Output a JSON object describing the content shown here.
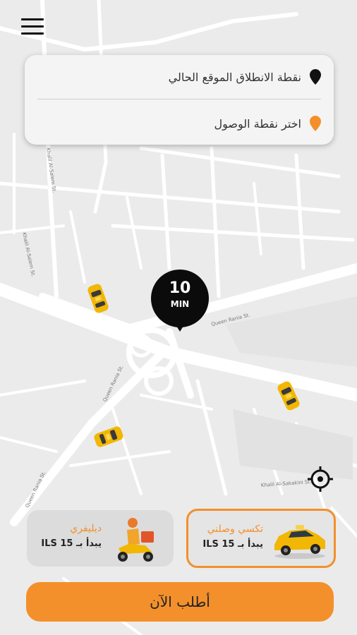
{
  "menu": {
    "icon": "hamburger-menu-icon"
  },
  "route": {
    "pickup": {
      "label": "نقطة الانطلاق الموقع الحالي",
      "icon": "black-location-pin-icon"
    },
    "destination": {
      "label": "اختر نقطة الوصول",
      "icon": "orange-location-pin-icon"
    }
  },
  "eta": {
    "value": "10",
    "unit": "MIN"
  },
  "streets": [
    "Khalil Al-Sakakini St.",
    "Queen Rania St.",
    "Khalil Al-Salem St.",
    "Queen Rania St.",
    "Queen Rania St."
  ],
  "services": [
    {
      "name": "تكسي وصلني",
      "price": "يبدأ بـ ILS 15",
      "icon": "taxi-car-icon",
      "selected": true
    },
    {
      "name": "ديليفري",
      "price": "يبدأ بـ ILS 15",
      "icon": "delivery-scooter-icon",
      "selected": false
    }
  ],
  "order_button": {
    "label": "أطلب الآن"
  },
  "colors": {
    "accent": "#f3902b",
    "map_bg": "#ececec",
    "road": "#ffffff",
    "marker": "#0b0b0b"
  }
}
